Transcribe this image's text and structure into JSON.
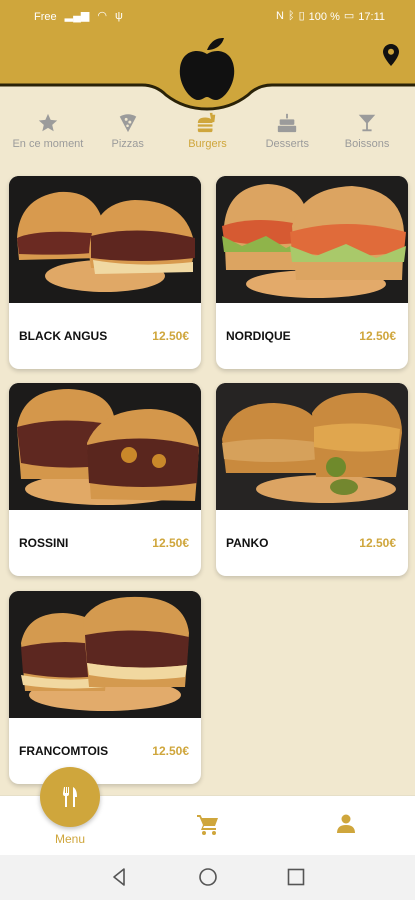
{
  "status_bar": {
    "carrier": "Free",
    "battery": "100 %",
    "time": "17:11"
  },
  "colors": {
    "brand_gold": "#cfa63c",
    "background": "#f1e8cf",
    "inactive_gray": "#9b9b9b"
  },
  "categories": [
    {
      "label": "En ce moment",
      "icon": "star-icon",
      "active": false
    },
    {
      "label": "Pizzas",
      "icon": "pizza-icon",
      "active": false
    },
    {
      "label": "Burgers",
      "icon": "burger-icon",
      "active": true
    },
    {
      "label": "Desserts",
      "icon": "cake-icon",
      "active": false
    },
    {
      "label": "Boissons",
      "icon": "cocktail-icon",
      "active": false
    }
  ],
  "products": [
    {
      "name": "BLACK ANGUS",
      "price": "12.50€"
    },
    {
      "name": "NORDIQUE",
      "price": "12.50€"
    },
    {
      "name": "ROSSINI",
      "price": "12.50€"
    },
    {
      "name": "PANKO",
      "price": "12.50€"
    },
    {
      "name": "FRANCOMTOIS",
      "price": "12.50€"
    }
  ],
  "bottom_nav": {
    "menu_label": "Menu"
  }
}
